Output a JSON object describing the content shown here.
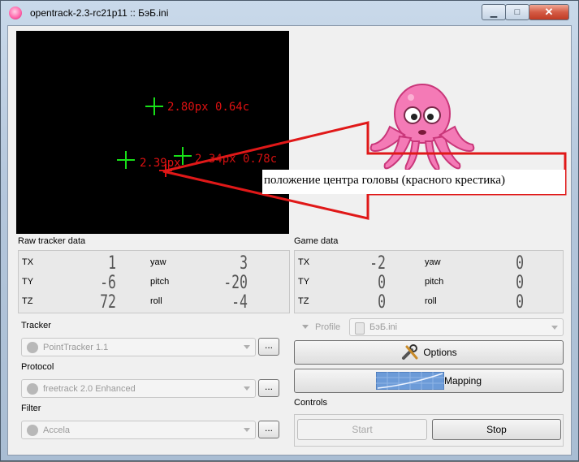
{
  "window": {
    "title": "opentrack-2.3-rc21p11 :: БэБ.ini",
    "minimize_glyph": "▁",
    "maximize_glyph": "□",
    "close_glyph": "✕"
  },
  "video": {
    "labels": [
      {
        "text": "2.80px 0.64c"
      },
      {
        "text": "2.39px"
      },
      {
        "text": "2.34px 0.78c"
      }
    ]
  },
  "raw_tracker": {
    "title": "Raw tracker data",
    "rows": [
      {
        "left_label": "TX",
        "left_value": "1",
        "right_label": "yaw",
        "right_value": "3"
      },
      {
        "left_label": "TY",
        "left_value": "-6",
        "right_label": "pitch",
        "right_value": "-20"
      },
      {
        "left_label": "TZ",
        "left_value": "72",
        "right_label": "roll",
        "right_value": "-4"
      }
    ]
  },
  "game_data": {
    "title": "Game data",
    "rows": [
      {
        "left_label": "TX",
        "left_value": "-2",
        "right_label": "yaw",
        "right_value": "0"
      },
      {
        "left_label": "TY",
        "left_value": "0",
        "right_label": "pitch",
        "right_value": "0"
      },
      {
        "left_label": "TZ",
        "left_value": "0",
        "right_label": "roll",
        "right_value": "0"
      }
    ]
  },
  "tracker": {
    "title": "Tracker",
    "value": "PointTracker 1.1",
    "button": "..."
  },
  "protocol": {
    "title": "Protocol",
    "value": "freetrack 2.0 Enhanced",
    "button": "..."
  },
  "filter": {
    "title": "Filter",
    "value": "Accela",
    "button": "..."
  },
  "profile": {
    "label": "Profile",
    "value": "БэБ.ini"
  },
  "buttons": {
    "options": "Options",
    "mapping": "Mapping"
  },
  "controls": {
    "title": "Controls",
    "start": "Start",
    "stop": "Stop"
  },
  "annotation": {
    "text": "положение центра головы (красного крестика)"
  },
  "colors": {
    "track_marker": "#18e018",
    "head_center": "#dd1111",
    "annotation_arrow": "#e01818"
  }
}
